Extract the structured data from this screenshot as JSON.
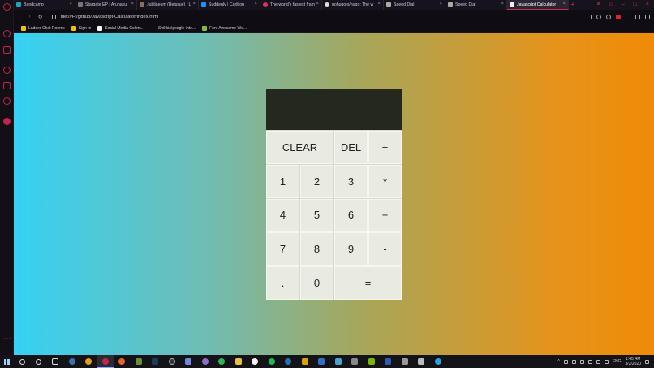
{
  "browser": {
    "tabs": [
      {
        "title": "Bandcamp",
        "color": "#1da0c3"
      },
      {
        "title": "Stargate EP | Arunaku",
        "color": "#777777"
      },
      {
        "title": "Jubilaeum (Reissue) | L",
        "color": "#8a6f5a"
      },
      {
        "title": "Suddenly | Caribou",
        "color": "#1e90ff"
      },
      {
        "title": "The world's fastest fram",
        "color": "#e0306a"
      },
      {
        "title": "gohugoio/hugo: The w",
        "color": "#dddddd"
      },
      {
        "title": "Speed Dial",
        "color": "#aaaaaa"
      },
      {
        "title": "Speed Dial",
        "color": "#aaaaaa"
      },
      {
        "title": "Javascript Calculator",
        "color": "#eeeeee"
      }
    ],
    "url": "file:///F:/github/Javascript-Calculator/index.html",
    "bookmarks": [
      {
        "label": "Ladder Chat Rooms",
        "color": "#f2c200"
      },
      {
        "label": "Sign In",
        "color": "#f2c200"
      },
      {
        "label": "Social Media Colors...",
        "color": "#ffffff"
      },
      {
        "label": "Shikkic/google-inte...",
        "color": "#0f0c13"
      },
      {
        "label": "Font Awesome We...",
        "color": "#7ac143"
      }
    ]
  },
  "calculator": {
    "display": "",
    "keys": {
      "clear": "CLEAR",
      "del": "DEL",
      "divide": "÷",
      "one": "1",
      "two": "2",
      "three": "3",
      "multiply": "*",
      "four": "4",
      "five": "5",
      "six": "6",
      "plus": "+",
      "seven": "7",
      "eight": "8",
      "nine": "9",
      "minus": "-",
      "decimal": ".",
      "zero": "0",
      "equals": "="
    }
  },
  "taskbar": {
    "language": "ENG",
    "time": "1:45 AM",
    "date": "3/2/2020"
  }
}
